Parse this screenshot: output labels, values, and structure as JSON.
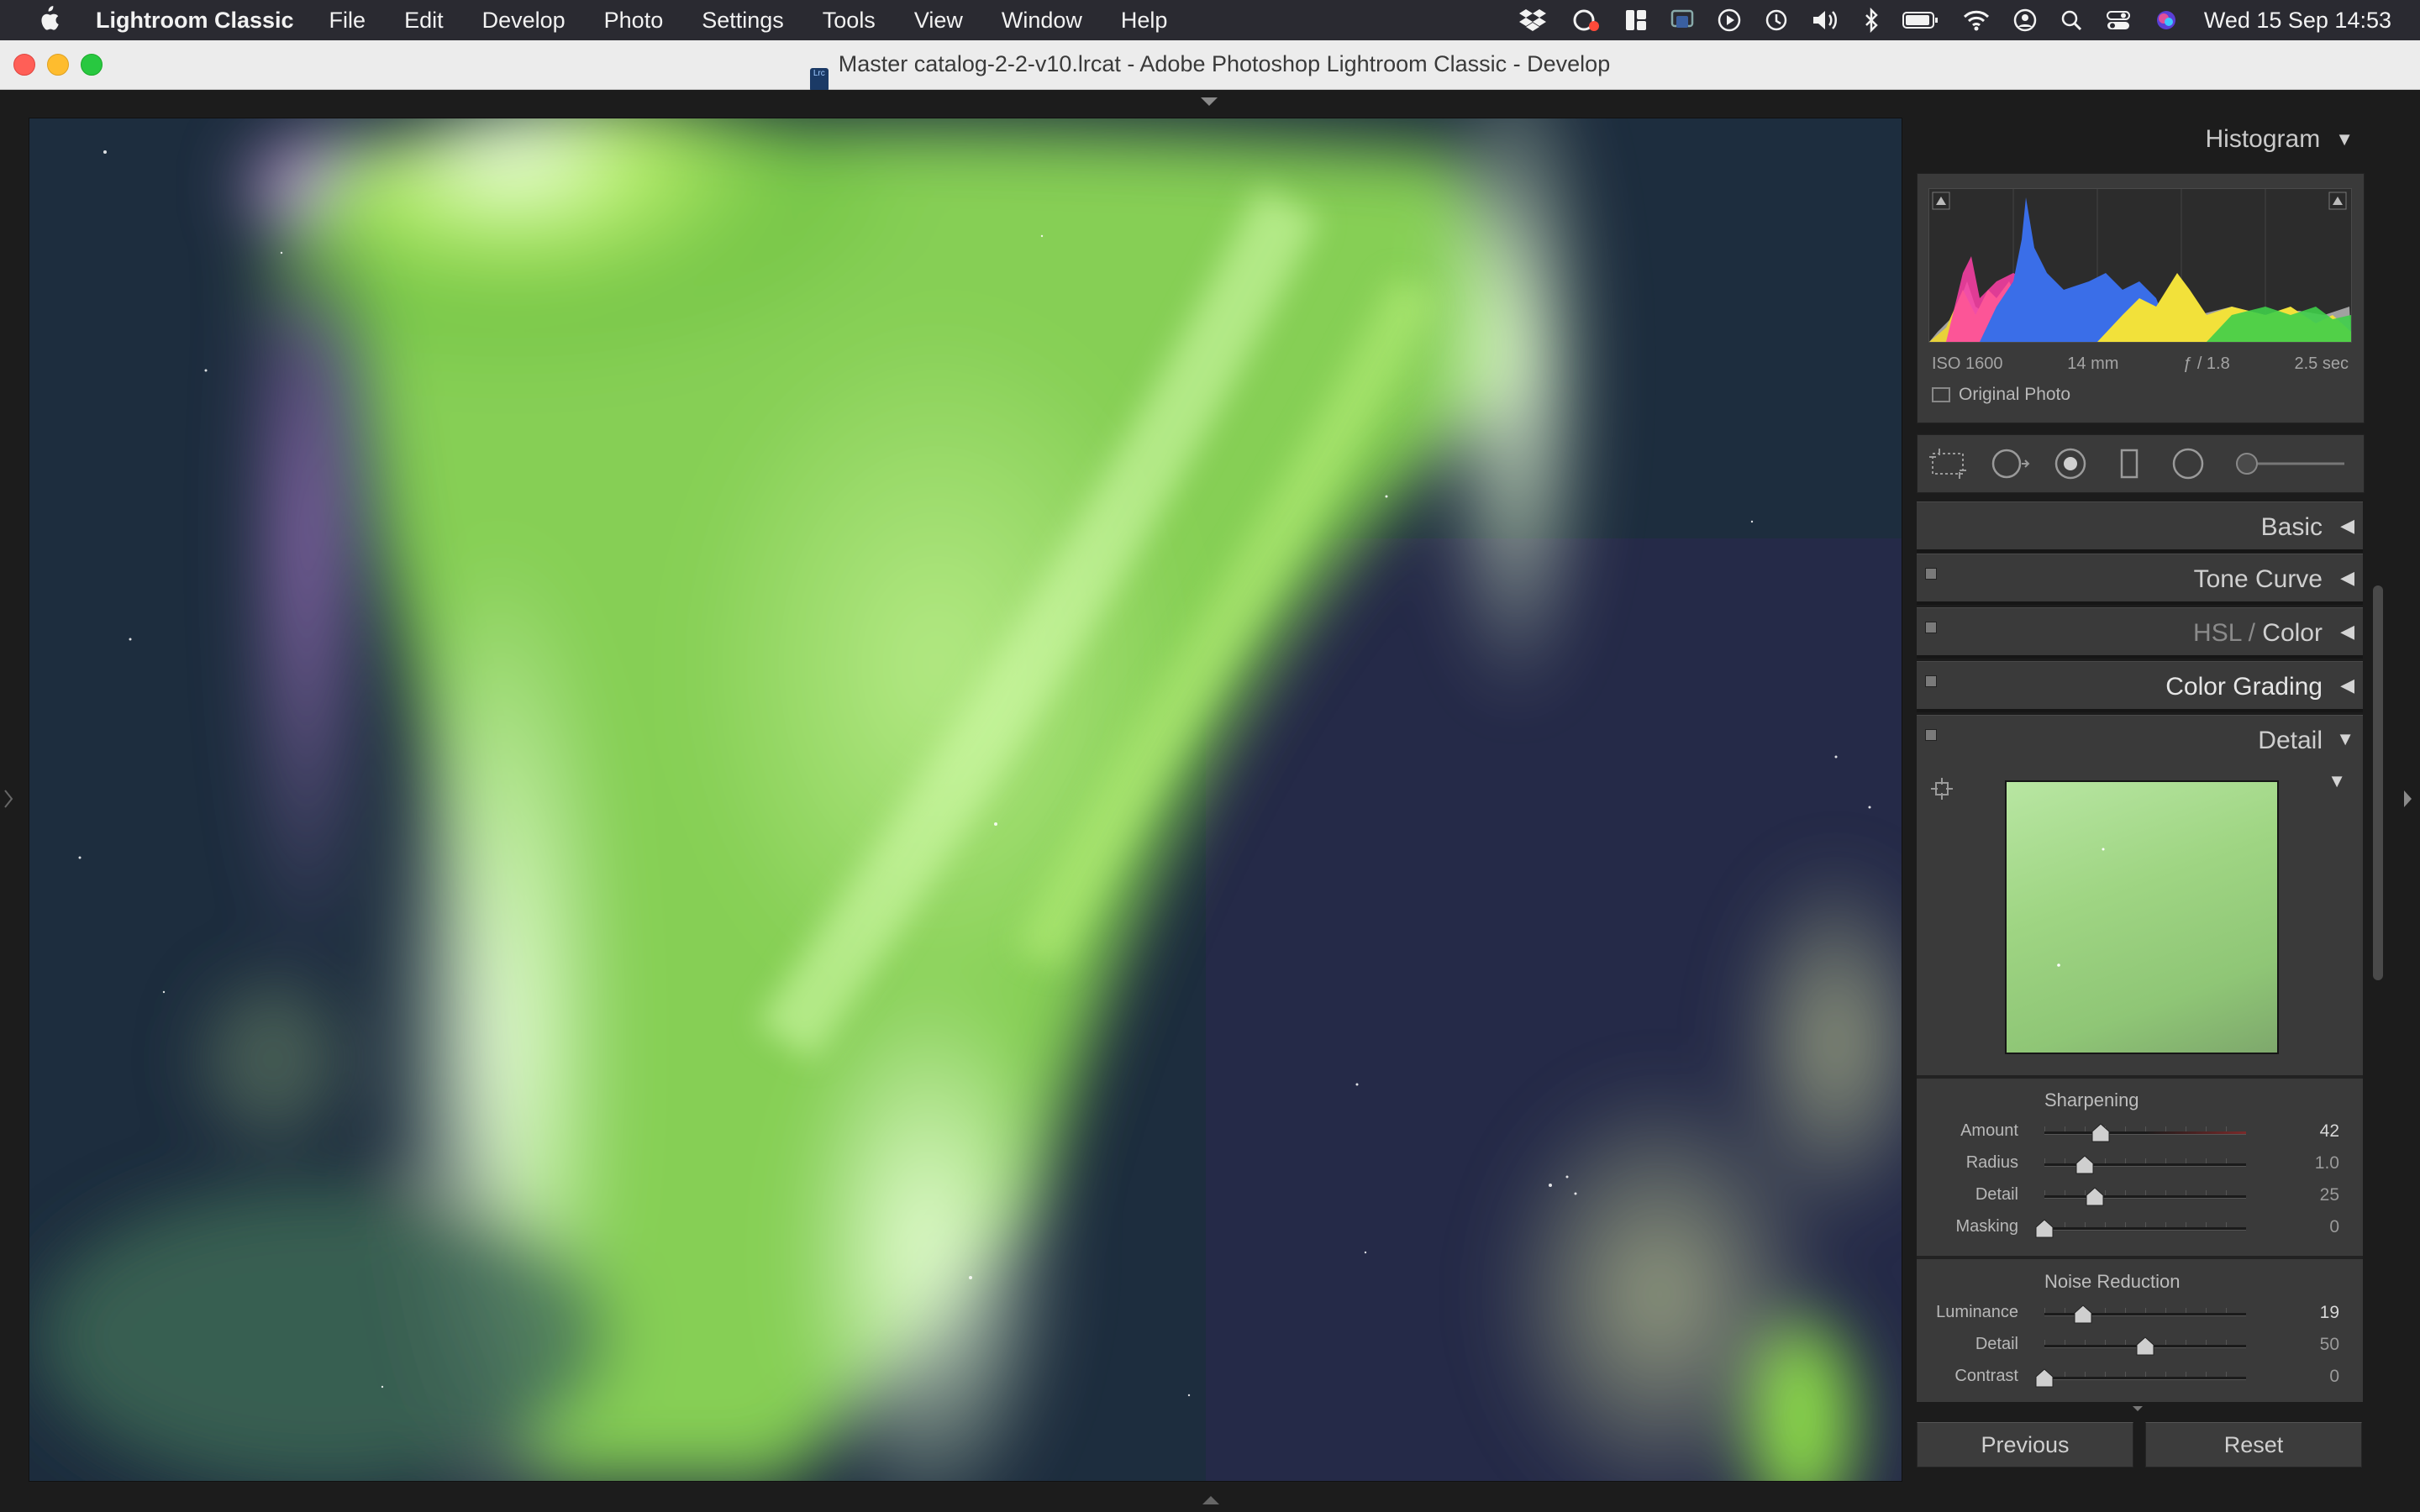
{
  "menubar": {
    "app_name": "Lightroom Classic",
    "menus": [
      "File",
      "Edit",
      "Develop",
      "Photo",
      "Settings",
      "Tools",
      "View",
      "Window",
      "Help"
    ],
    "status_icons": [
      "dropbox-icon",
      "creative-cloud-icon",
      "stage-manager-icon",
      "screen-share-icon",
      "play-icon",
      "time-machine-icon",
      "volume-icon",
      "bluetooth-icon",
      "battery-icon",
      "wifi-icon",
      "user-icon",
      "spotlight-icon",
      "control-center-icon",
      "siri-icon"
    ],
    "clock": "Wed 15 Sep  14:53"
  },
  "window": {
    "doc_icon": "Lrc",
    "title": "Master catalog-2-2-v10.lrcat - Adobe Photoshop Lightroom Classic - Develop"
  },
  "histogram": {
    "title": "Histogram",
    "iso": "ISO 1600",
    "focal": "14 mm",
    "aperture": "ƒ / 1.8",
    "shutter": "2.5 sec",
    "original_photo": "Original Photo"
  },
  "sections": {
    "basic": "Basic",
    "tone_curve": "Tone Curve",
    "hsl": "HSL",
    "hsl_sep": " / ",
    "color": "Color",
    "color_grading": "Color Grading",
    "detail": "Detail"
  },
  "sharpening": {
    "title": "Sharpening",
    "sliders": [
      {
        "label": "Amount",
        "value": "42",
        "level": 0.28
      },
      {
        "label": "Radius",
        "value": "1.0",
        "level": 0.2
      },
      {
        "label": "Detail",
        "value": "25",
        "level": 0.25
      },
      {
        "label": "Masking",
        "value": "0",
        "level": 0
      }
    ]
  },
  "noise_reduction": {
    "title": "Noise Reduction",
    "sliders": [
      {
        "label": "Luminance",
        "value": "19",
        "level": 0.19
      },
      {
        "label": "Detail",
        "value": "50",
        "level": 0.5
      },
      {
        "label": "Contrast",
        "value": "0",
        "level": 0
      }
    ]
  },
  "footer": {
    "previous": "Previous",
    "reset": "Reset"
  },
  "colors": {
    "panel_bg": "#3a3a3a",
    "app_bg": "#1c1c1c",
    "aurora_green": "#9be05a"
  }
}
